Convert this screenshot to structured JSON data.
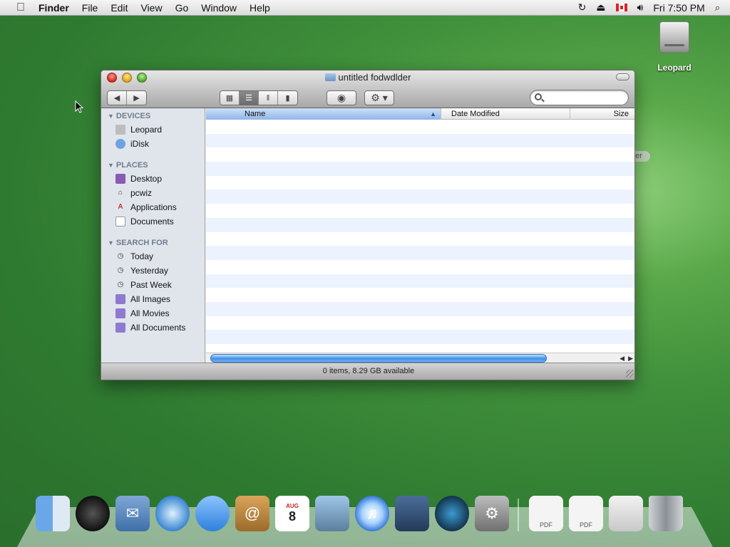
{
  "menubar": {
    "app": "Finder",
    "items": [
      "File",
      "Edit",
      "View",
      "Go",
      "Window",
      "Help"
    ],
    "clock": "Fri 7:50 PM"
  },
  "desktop": {
    "icon_label": "Leopard",
    "cursor": "pointer-cursor"
  },
  "window": {
    "title": "untitled fodwdlder",
    "status": "0 items, 8.29 GB available",
    "search": {
      "placeholder": ""
    },
    "view_mode_selected": "list"
  },
  "sidebar": {
    "devices": {
      "heading": "DEVICES",
      "items": [
        {
          "label": "Leopard",
          "icon": "hard-disk-icon"
        },
        {
          "label": "iDisk",
          "icon": "idisk-icon"
        }
      ]
    },
    "places": {
      "heading": "PLACES",
      "items": [
        {
          "label": "Desktop",
          "icon": "desktop-icon"
        },
        {
          "label": "pcwiz",
          "icon": "home-icon"
        },
        {
          "label": "Applications",
          "icon": "applications-icon"
        },
        {
          "label": "Documents",
          "icon": "documents-icon"
        }
      ]
    },
    "search_for": {
      "heading": "SEARCH FOR",
      "items": [
        {
          "label": "Today",
          "icon": "clock-icon"
        },
        {
          "label": "Yesterday",
          "icon": "clock-icon"
        },
        {
          "label": "Past Week",
          "icon": "clock-icon"
        },
        {
          "label": "All Images",
          "icon": "smart-folder-icon"
        },
        {
          "label": "All Movies",
          "icon": "smart-folder-icon"
        },
        {
          "label": "All Documents",
          "icon": "smart-folder-icon"
        }
      ]
    }
  },
  "columns": {
    "name": "Name",
    "date_modified": "Date Modified",
    "size": "Size"
  },
  "dock": {
    "items": [
      "finder-icon",
      "dashboard-icon",
      "mail-icon",
      "safari-icon",
      "ichat-icon",
      "address-book-icon",
      "ical-icon",
      "iphoto-icon",
      "itunes-icon",
      "spaces-icon",
      "time-machine-icon",
      "system-preferences-icon",
      "pdf-document-icon",
      "pdf-document-icon",
      "screenshot-icon",
      "trash-icon"
    ],
    "ical_month": "AUG",
    "ical_day": "8"
  },
  "colors": {
    "accent": "#3f8fe6",
    "desktop_green": "#3f8f3b"
  }
}
